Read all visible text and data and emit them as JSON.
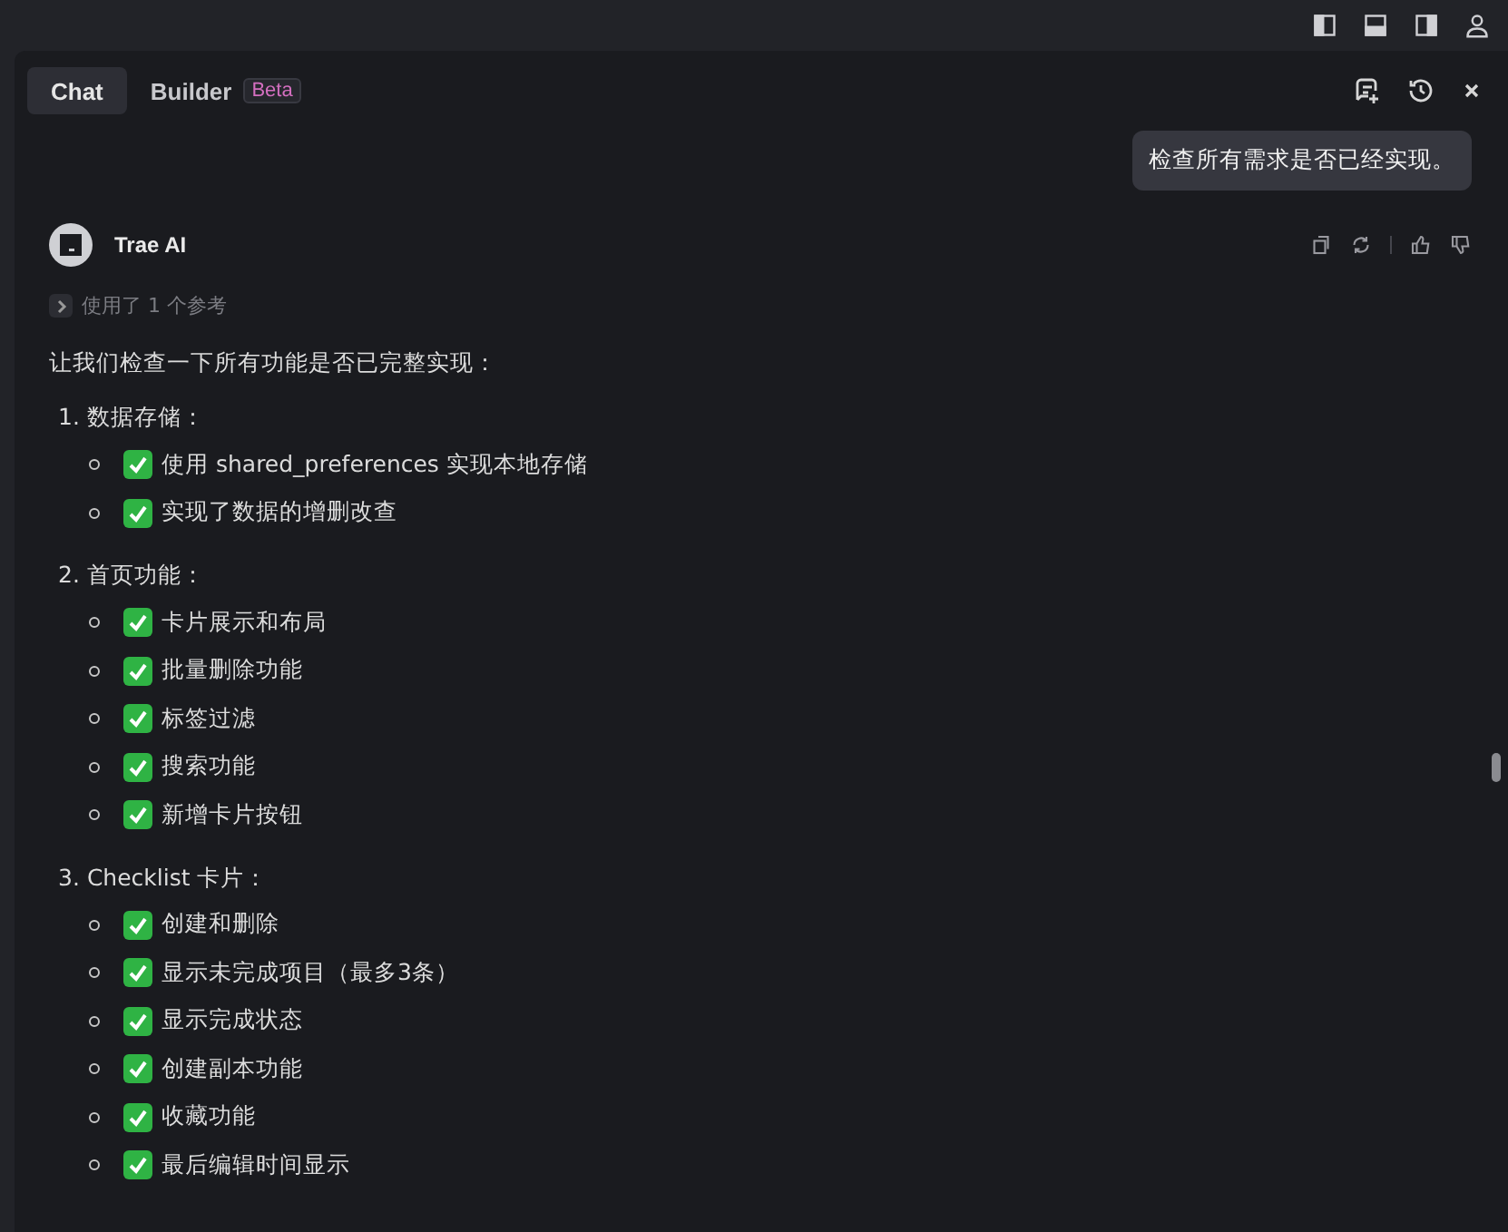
{
  "tabs": [
    {
      "label": "Chat",
      "selected": true
    },
    {
      "label": "Builder",
      "selected": false,
      "badge": "Beta"
    }
  ],
  "user_message": "检查所有需求是否已经实现。",
  "assistant": {
    "name": "Trae AI",
    "references": "使用了 1 个参考",
    "intro": "让我们检查一下所有功能是否已完整实现：",
    "sections": [
      {
        "number": "1.",
        "title": "数据存储：",
        "items": [
          "使用 shared_preferences 实现本地存储",
          "实现了数据的增删改查"
        ]
      },
      {
        "number": "2.",
        "title": "首页功能：",
        "items": [
          "卡片展示和布局",
          "批量删除功能",
          "标签过滤",
          "搜索功能",
          "新增卡片按钮"
        ]
      },
      {
        "number": "3.",
        "title": "Checklist 卡片：",
        "items": [
          "创建和删除",
          "显示未完成项目（最多3条）",
          "显示完成状态",
          "创建副本功能",
          "收藏功能",
          "最后编辑时间显示"
        ]
      }
    ]
  }
}
